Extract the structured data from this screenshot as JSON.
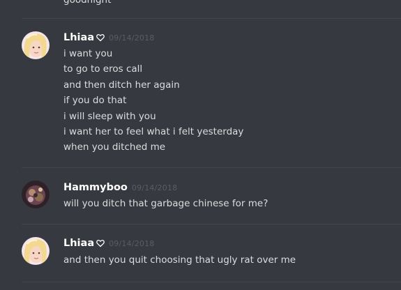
{
  "cut_message": "goodnight",
  "messages": [
    {
      "username": "Lhiaa",
      "badge": "heart-icon",
      "timestamp": "09/14/2018",
      "lines": [
        "i want you",
        "to go to eros call",
        "and then ditch her again",
        "if you do that",
        "i will sleep with you",
        "i want her to feel what i felt yesterday",
        "when you ditched me"
      ]
    },
    {
      "username": "Hammyboo",
      "timestamp": "09/14/2018",
      "lines": [
        "will you ditch that garbage chinese for me?"
      ]
    },
    {
      "username": "Lhiaa",
      "badge": "heart-icon",
      "timestamp": "09/14/2018",
      "lines": [
        "and then you quit choosing that ugly rat over me"
      ]
    }
  ],
  "colors": {
    "background": "#36393f",
    "divider": "#42454a",
    "username": "#ffffff",
    "message_text": "#dcddde",
    "timestamp": "#5a5d63"
  }
}
